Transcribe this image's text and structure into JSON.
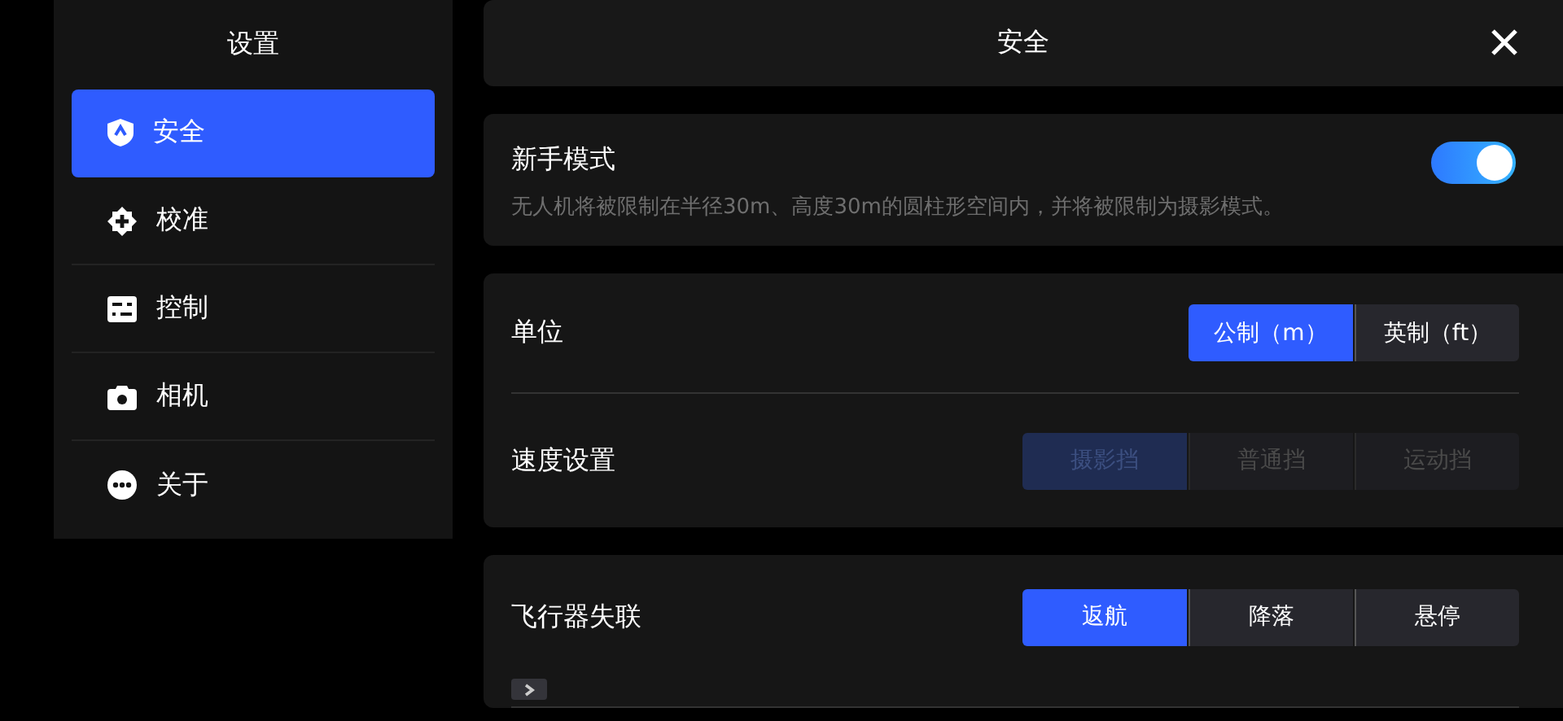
{
  "sidebar": {
    "title": "设置",
    "items": [
      {
        "label": "安全",
        "kind": "shield",
        "selected": true
      },
      {
        "label": "校准",
        "kind": "target",
        "selected": false
      },
      {
        "label": "控制",
        "kind": "sliders",
        "selected": false
      },
      {
        "label": "相机",
        "kind": "camera",
        "selected": false
      },
      {
        "label": "关于",
        "kind": "more",
        "selected": false
      }
    ]
  },
  "header": {
    "title": "安全"
  },
  "cards": [
    {
      "rows": [
        {
          "kind": "toggle",
          "label": "新手模式",
          "description": "无人机将被限制在半径30m、高度30m的圆柱形空间内，并将被限制为摄影模式。",
          "on": true
        }
      ]
    },
    {
      "rows": [
        {
          "kind": "segmented",
          "label": "单位",
          "disabled": false,
          "options": [
            {
              "label": "公制（m）",
              "selected": true
            },
            {
              "label": "英制（ft）",
              "selected": false
            }
          ]
        },
        {
          "kind": "segmented",
          "label": "速度设置",
          "disabled": true,
          "options": [
            {
              "label": "摄影挡",
              "selected": true
            },
            {
              "label": "普通挡",
              "selected": false
            },
            {
              "label": "运动挡",
              "selected": false
            }
          ]
        }
      ]
    },
    {
      "rows": [
        {
          "kind": "segmented",
          "label": "飞行器失联",
          "disabled": false,
          "expanded": false,
          "options": [
            {
              "label": "返航",
              "selected": true
            },
            {
              "label": "降落",
              "selected": false
            },
            {
              "label": "悬停",
              "selected": false
            }
          ]
        }
      ]
    }
  ]
}
